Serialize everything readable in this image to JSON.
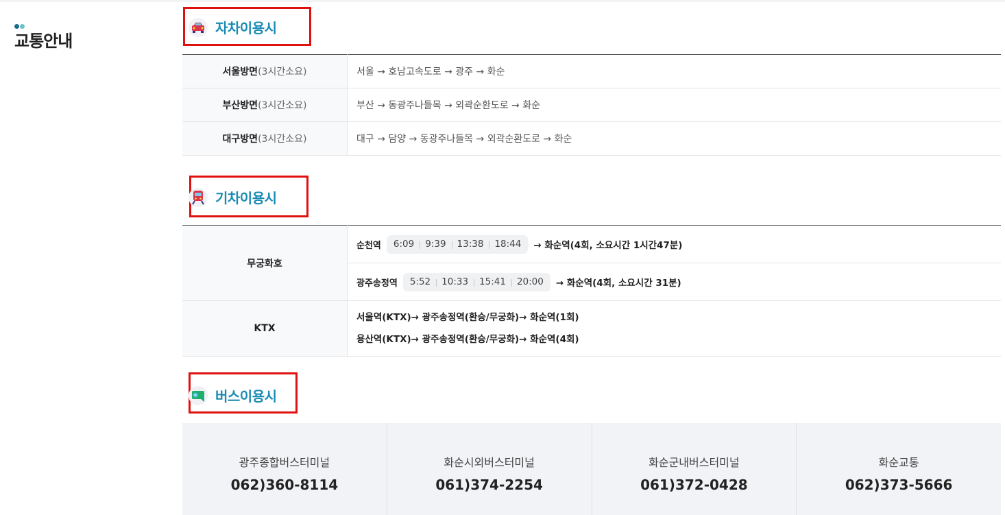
{
  "sidebar": {
    "title": "교통안내",
    "dot_colors": [
      "#1a6a8a",
      "#6cc0c8"
    ]
  },
  "car": {
    "title": "자차이용시",
    "icon": "car-icon",
    "rows": [
      {
        "label": "서울방면",
        "duration": "(3시간소요)",
        "route": "서울 → 호남고속도로 → 광주 → 화순"
      },
      {
        "label": "부산방면",
        "duration": "(3시간소요)",
        "route": "부산 → 동광주나들목 → 외곽순환도로 → 화순"
      },
      {
        "label": "대구방면",
        "duration": "(3시간소요)",
        "route": "대구 → 담양 → 동광주나들목 → 외곽순환도로 → 화순"
      }
    ]
  },
  "train": {
    "title": "기차이용시",
    "icon": "train-icon",
    "mugunghwa": {
      "label": "무궁화호",
      "stations": [
        {
          "name": "순천역",
          "times": [
            "6:09",
            "9:39",
            "13:38",
            "18:44"
          ],
          "info": "→ 화순역(4회, 소요시간 1시간47분)"
        },
        {
          "name": "광주송정역",
          "times": [
            "5:52",
            "10:33",
            "15:41",
            "20:00"
          ],
          "info": "→ 화순역(4회, 소요시간 31분)"
        }
      ]
    },
    "ktx": {
      "label": "KTX",
      "lines": [
        "서울역(KTX)→ 광주송정역(환승/무궁화)→ 화순역(1회)",
        "용산역(KTX)→ 광주송정역(환승/무궁화)→ 화순역(4회)"
      ]
    }
  },
  "bus": {
    "title": "버스이용시",
    "icon": "bus-chat-icon",
    "terminals": [
      {
        "name": "광주종합버스터미널",
        "phone": "062)360-8114"
      },
      {
        "name": "화순시외버스터미널",
        "phone": "061)374-2254"
      },
      {
        "name": "화순군내버스터미널",
        "phone": "061)372-0428"
      },
      {
        "name": "화순교통",
        "phone": "062)373-5666"
      }
    ]
  },
  "colors": {
    "accent": "#1a8bb3",
    "highlight_box": "#e0100f"
  }
}
